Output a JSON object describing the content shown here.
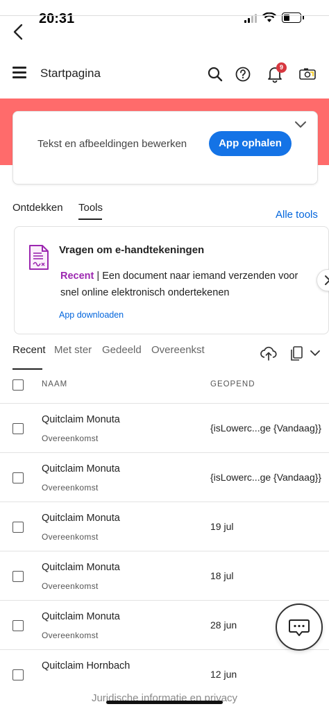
{
  "status_bar": {
    "time": "20:31"
  },
  "header": {
    "title": "Startpagina",
    "notification_count": "9"
  },
  "promo": {
    "text": "Tekst en afbeeldingen bewerken",
    "button": "App ophalen"
  },
  "main_tabs": [
    {
      "label": "Ontdekken"
    },
    {
      "label": "Tools"
    }
  ],
  "all_tools_link": "Alle tools",
  "tool_card": {
    "title": "Vragen om e-handtekeningen",
    "recent_tag": "Recent",
    "separator": "|",
    "description": "Een document naar iemand verzenden voor snel online elektronisch ondertekenen",
    "link": "App downloaden"
  },
  "file_tabs": [
    {
      "label": "Recent"
    },
    {
      "label": "Met ster"
    },
    {
      "label": "Gedeeld"
    },
    {
      "label": "Overeenkst"
    }
  ],
  "table": {
    "col_name": "NAAM",
    "col_opened": "GEOPEND",
    "rows": [
      {
        "name": "Quitclaim Monuta",
        "type": "Overeenkomst",
        "date": "{isLowerc...ge {Vandaag}}"
      },
      {
        "name": "Quitclaim Monuta",
        "type": "Overeenkomst",
        "date": "{isLowerc...ge {Vandaag}}"
      },
      {
        "name": "Quitclaim Monuta",
        "type": "Overeenkomst",
        "date": "19 jul"
      },
      {
        "name": "Quitclaim Monuta",
        "type": "Overeenkomst",
        "date": "18 jul"
      },
      {
        "name": "Quitclaim Monuta",
        "type": "Overeenkomst",
        "date": "28 jun"
      },
      {
        "name": "Quitclaim Hornbach",
        "type": "",
        "date": "12 jun"
      }
    ]
  },
  "footer": "Juridische informatie en privacy",
  "colors": {
    "accent": "#1473e6",
    "hero": "#ff6b6b",
    "recent": "#9c27b0",
    "link": "#0265dc",
    "badge": "#d7373f"
  },
  "icons": [
    "back-arrow-icon",
    "menu-icon",
    "search-icon",
    "help-icon",
    "bell-icon",
    "camera-scan-icon",
    "chevron-down-icon",
    "e-sign-doc-icon",
    "chevron-right-icon",
    "upload-icon",
    "copy-icon",
    "chat-icon"
  ]
}
